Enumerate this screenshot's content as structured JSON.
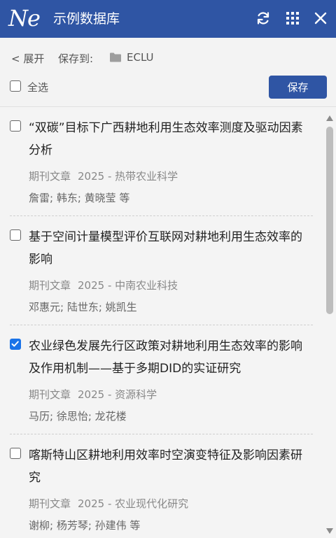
{
  "header": {
    "logo": "Ne",
    "title": "示例数据库"
  },
  "toolbar": {
    "expand_label": "< 展开",
    "save_to_label": "保存到:",
    "collection_name": "ECLU",
    "select_all_label": "全选",
    "select_all_checked": false,
    "save_label": "保存"
  },
  "items": [
    {
      "checked": false,
      "title": "“双碳”目标下广西耕地利用生态效率测度及驱动因素分析",
      "type": "期刊文章",
      "year_source": "2025 - 热带农业科学",
      "authors": "詹雷; 韩东; 黄晓莹 等"
    },
    {
      "checked": false,
      "title": "基于空间计量模型评价互联网对耕地利用生态效率的影响",
      "type": "期刊文章",
      "year_source": "2025 - 中南农业科技",
      "authors": "邓惠元; 陆世东; 姚凯生"
    },
    {
      "checked": true,
      "title": "农业绿色发展先行区政策对耕地利用生态效率的影响及作用机制——基于多期DID的实证研究",
      "type": "期刊文章",
      "year_source": "2025 - 资源科学",
      "authors": "马历; 徐思怡; 龙花楼"
    },
    {
      "checked": false,
      "title": "喀斯特山区耕地利用效率时空演变特征及影响因素研究",
      "type": "期刊文章",
      "year_source": "2025 - 农业现代化研究",
      "authors": "谢柳; 杨芳琴; 孙建伟 等"
    }
  ],
  "colors": {
    "brand": "#2f55a4",
    "checkbox_checked": "#1a73e8"
  },
  "icons": {
    "refresh": "refresh-icon",
    "grid": "grid-icon",
    "close": "close-icon",
    "folder": "folder-icon"
  }
}
